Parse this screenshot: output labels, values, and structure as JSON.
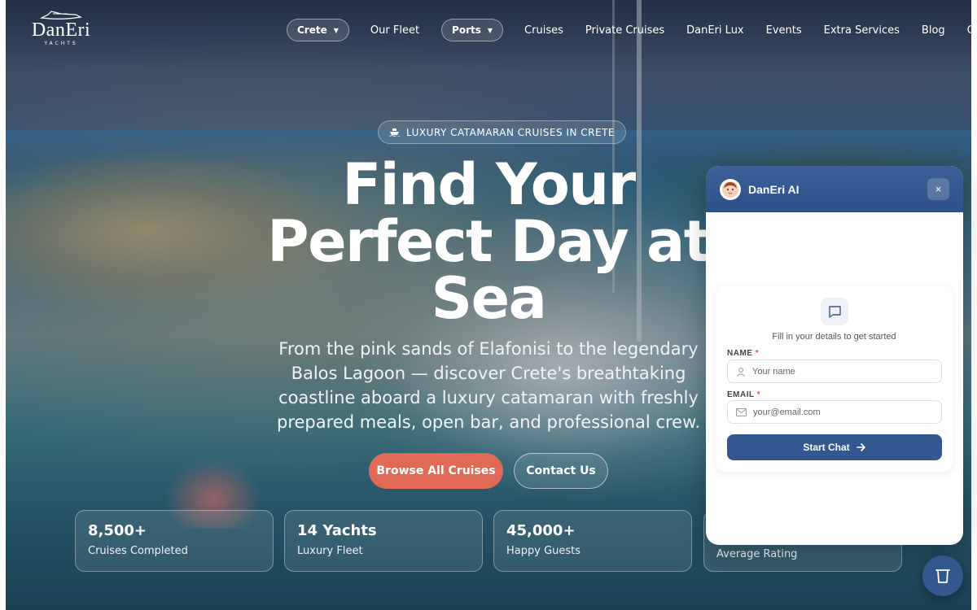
{
  "logo": {
    "name": "DanEri",
    "sub": "YACHTS"
  },
  "nav": {
    "region_label": "Crete",
    "fleet_label": "Our Fleet",
    "ports_label": "Ports",
    "links": [
      "Cruises",
      "Private Cruises",
      "DanEri Lux",
      "Events",
      "Extra Services",
      "Blog",
      "Contact"
    ]
  },
  "hero": {
    "badge": "LUXURY CATAMARAN CRUISES IN CRETE",
    "title_line1": "Find Your",
    "title_line2": "Perfect Day at",
    "title_line3": "Sea",
    "subtitle": "From the pink sands of Elafonisi to the legendary Balos Lagoon — discover Crete's breathtaking coastline aboard a luxury catamaran with freshly prepared meals, open bar, and professional crew.",
    "primary_cta": "Browse All Cruises",
    "secondary_cta": "Contact Us"
  },
  "stats": [
    {
      "value": "8,500+",
      "label": "Cruises Completed"
    },
    {
      "value": "14 Yachts",
      "label": "Luxury Fleet"
    },
    {
      "value": "45,000+",
      "label": "Happy Guests"
    },
    {
      "value": "",
      "label": "Average Rating"
    }
  ],
  "chat": {
    "title": "DanEri AI",
    "close": "×",
    "hint": "Fill in your details to get started",
    "name_label": "NAME",
    "name_placeholder": "Your name",
    "email_label": "EMAIL",
    "email_placeholder": "your@email.com",
    "required_mark": "*",
    "start_label": "Start Chat"
  },
  "colors": {
    "brand": "#35578f",
    "cta": "#e06a55"
  }
}
